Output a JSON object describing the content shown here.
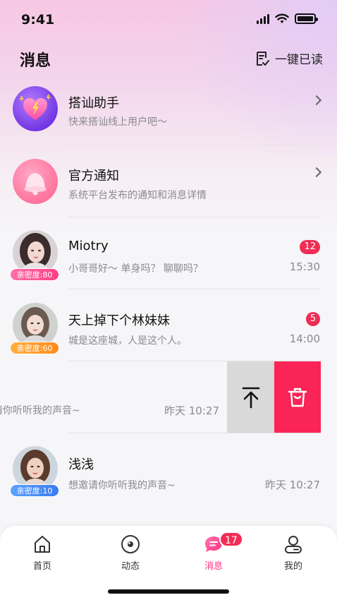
{
  "status_bar": {
    "time": "9:41"
  },
  "header": {
    "title": "消息",
    "read_all_label": "一键已读"
  },
  "rows": [
    {
      "title": "搭讪助手",
      "subtitle": "快来搭讪线上用户吧～"
    },
    {
      "title": "官方通知",
      "subtitle": "系统平台发布的通知和消息详情"
    },
    {
      "title": "Miotry",
      "subtitle": "小哥哥好～ 单身吗？ 聊聊吗？",
      "time": "15:30",
      "badge": "12",
      "intimacy": "亲密度:80"
    },
    {
      "title": "天上掉下个林妹妹",
      "subtitle": "城是这座城，人是这个人。",
      "time": "14:00",
      "badge": "5",
      "intimacy": "亲密度:60"
    },
    {
      "subtitle": "请你听听我的声音~",
      "time": "昨天 10:27"
    },
    {
      "title": "浅浅",
      "subtitle": "想邀请你听听我的声音~",
      "time": "昨天 10:27",
      "intimacy": "亲密度:10"
    }
  ],
  "tabbar": {
    "tabs": [
      {
        "label": "首页",
        "icon": "home-icon"
      },
      {
        "label": "动态",
        "icon": "moments-icon"
      },
      {
        "label": "消息",
        "icon": "message-icon",
        "badge": "17",
        "active": true
      },
      {
        "label": "我的",
        "icon": "profile-icon"
      }
    ]
  },
  "colors": {
    "accent": "#ff2e82",
    "badge": "#f12d55",
    "delete": "#fb2457",
    "pin": "#d9d9d9"
  }
}
